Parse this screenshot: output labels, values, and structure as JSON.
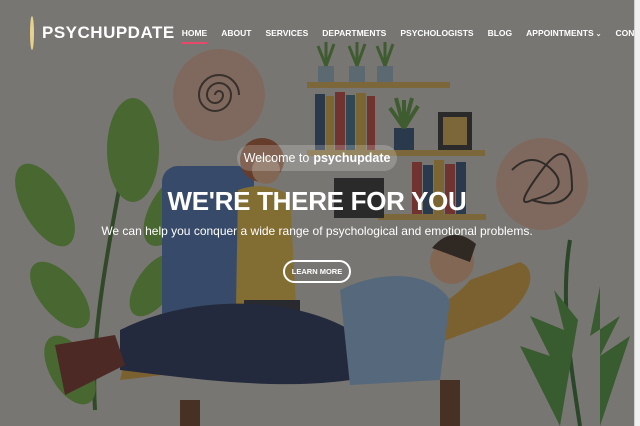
{
  "brand": {
    "name": "PSYCHUPDATE",
    "logo_icon": "brain-badge-icon"
  },
  "nav": {
    "items": [
      {
        "label": "HOME",
        "active": true
      },
      {
        "label": "ABOUT"
      },
      {
        "label": "SERVICES"
      },
      {
        "label": "DEPARTMENTS"
      },
      {
        "label": "PSYCHOLOGISTS"
      },
      {
        "label": "BLOG"
      },
      {
        "label": "APPOINTMENTS",
        "has_dropdown": true
      },
      {
        "label": "CONTACT"
      }
    ],
    "active_indicator_color": "#e8486a"
  },
  "hero": {
    "welcome_prefix": "Welcome to",
    "welcome_brand": "psychupdate",
    "headline": "WE'RE THERE FOR YOU",
    "subtext": "We can help you conquer a wide range of psychological and emotional problems.",
    "button_label": "LEARN MORE"
  }
}
